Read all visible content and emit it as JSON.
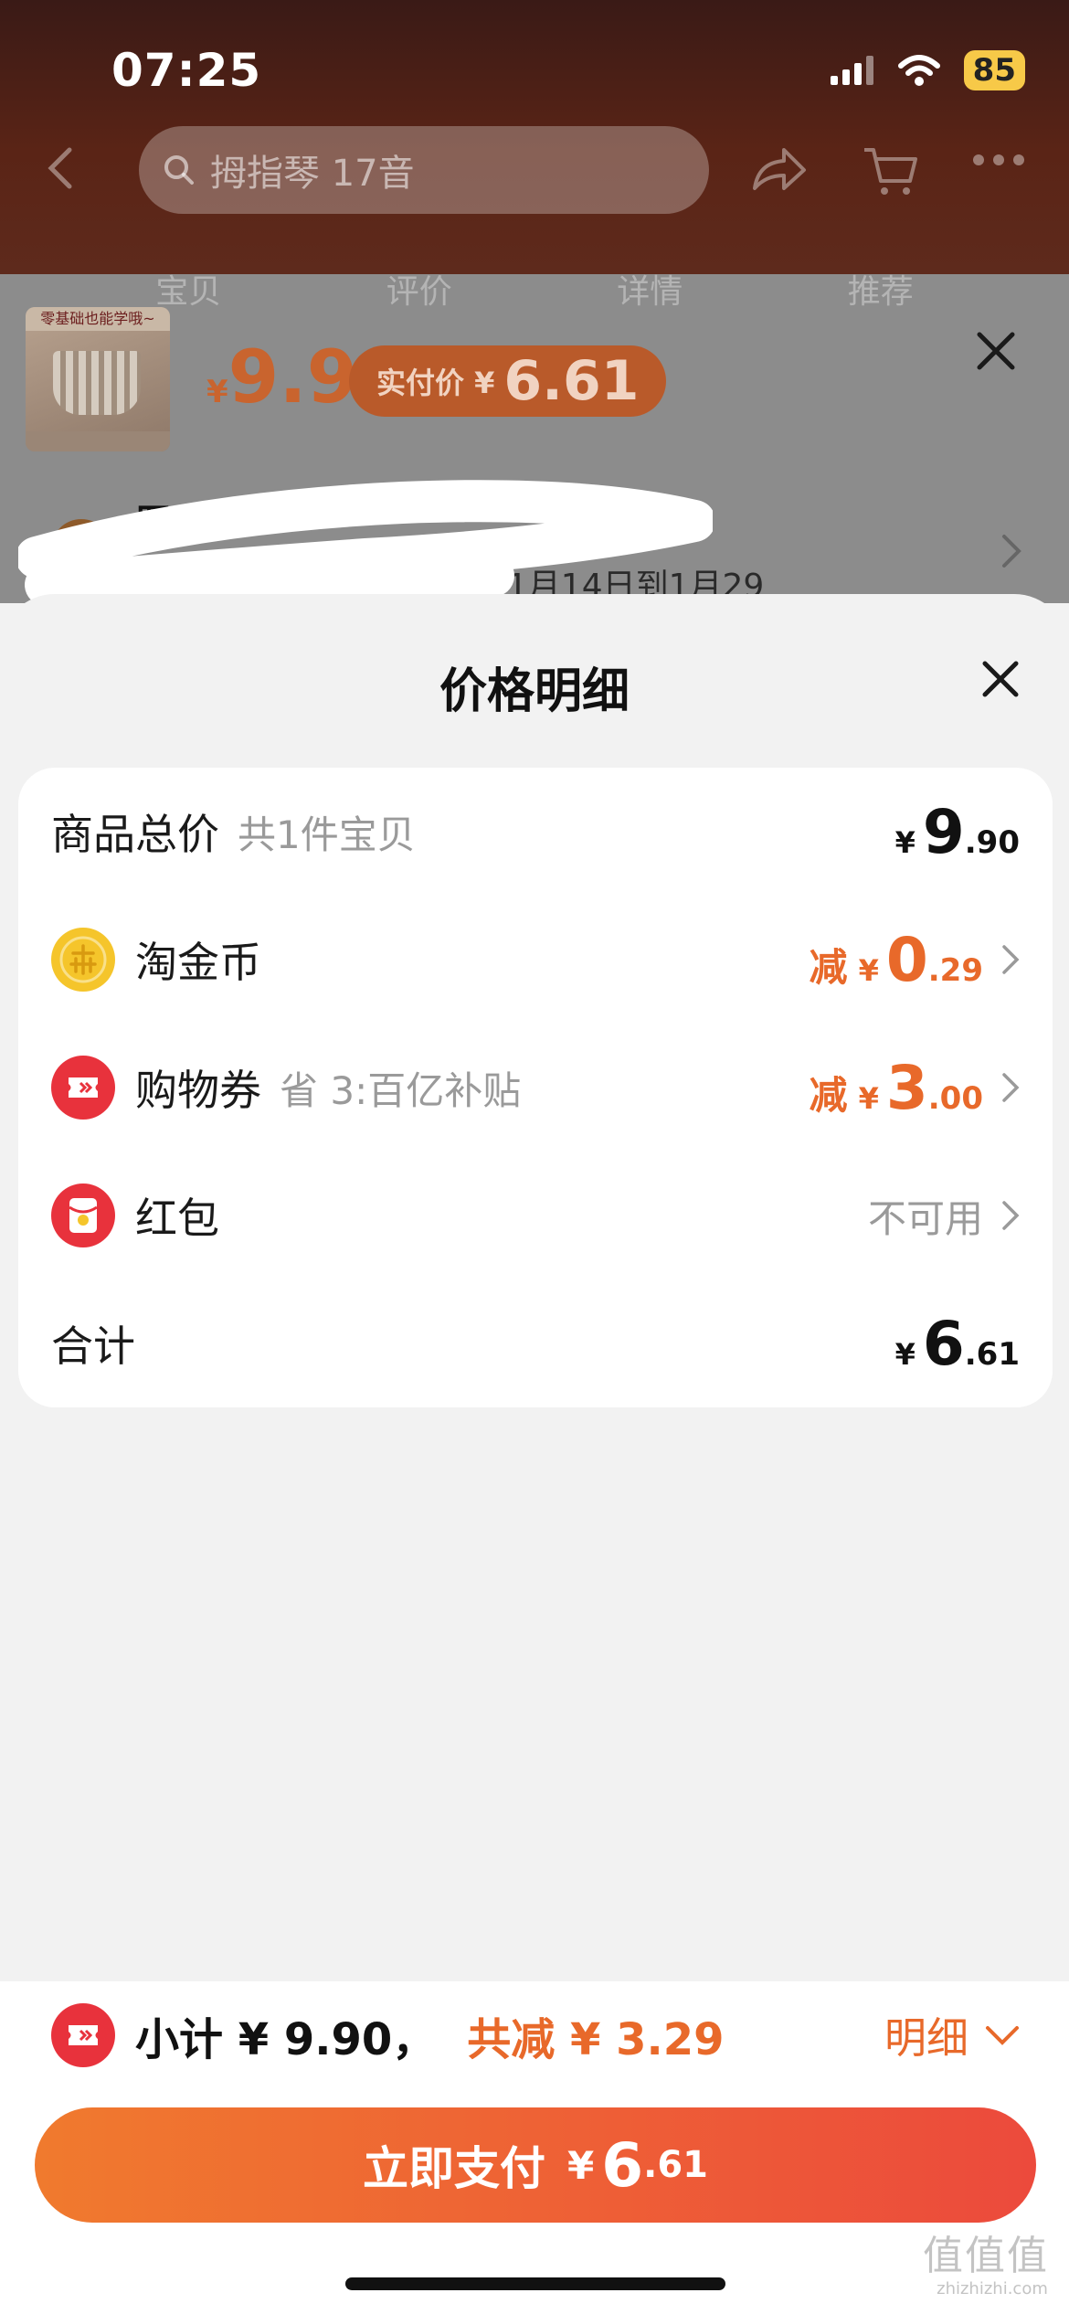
{
  "status_bar": {
    "time": "07:25",
    "battery": "85"
  },
  "nav": {
    "search_placeholder": "拇指琴 17音"
  },
  "tabs": [
    "宝贝",
    "评价",
    "详情",
    "推荐"
  ],
  "product": {
    "thumb_caption": "零基础也能学哦~",
    "price_yen": "¥",
    "price": "9.9",
    "real_price_label": "实付价 ¥",
    "real_price": "6.61"
  },
  "shop": {
    "title": "罗店",
    "delivery": "5在1月14日到1月29"
  },
  "sheet": {
    "title": "价格明细",
    "rows": [
      {
        "label": "商品总价",
        "sub": "共1件宝贝",
        "yen": "¥",
        "int": "9",
        "dec": ".90"
      },
      {
        "label": "淘金币",
        "icon": "coin-icon",
        "prefix": "减",
        "yen": "¥",
        "int": "0",
        "dec": ".29"
      },
      {
        "label": "购物券",
        "icon": "coupon-icon",
        "sub": "省 3:百亿补贴",
        "prefix": "减",
        "yen": "¥",
        "int": "3",
        "dec": ".00"
      },
      {
        "label": "红包",
        "icon": "red-packet-icon",
        "status": "不可用"
      },
      {
        "label": "合计",
        "yen": "¥",
        "int": "6",
        "dec": ".61"
      }
    ]
  },
  "bottom": {
    "subtotal": "小计 ¥ 9.90，",
    "saved": "共减 ¥ 3.29",
    "detail_link": "明细",
    "pay_label": "立即支付",
    "pay_yen": "¥",
    "pay_int": "6",
    "pay_dec": ".61"
  },
  "watermark": {
    "main": "值值值",
    "sub": "zhizhizhi.com"
  },
  "colors": {
    "accent_orange": "#e8692a",
    "coupon_red": "#e8323c",
    "coin_gold": "#f5c52b"
  }
}
